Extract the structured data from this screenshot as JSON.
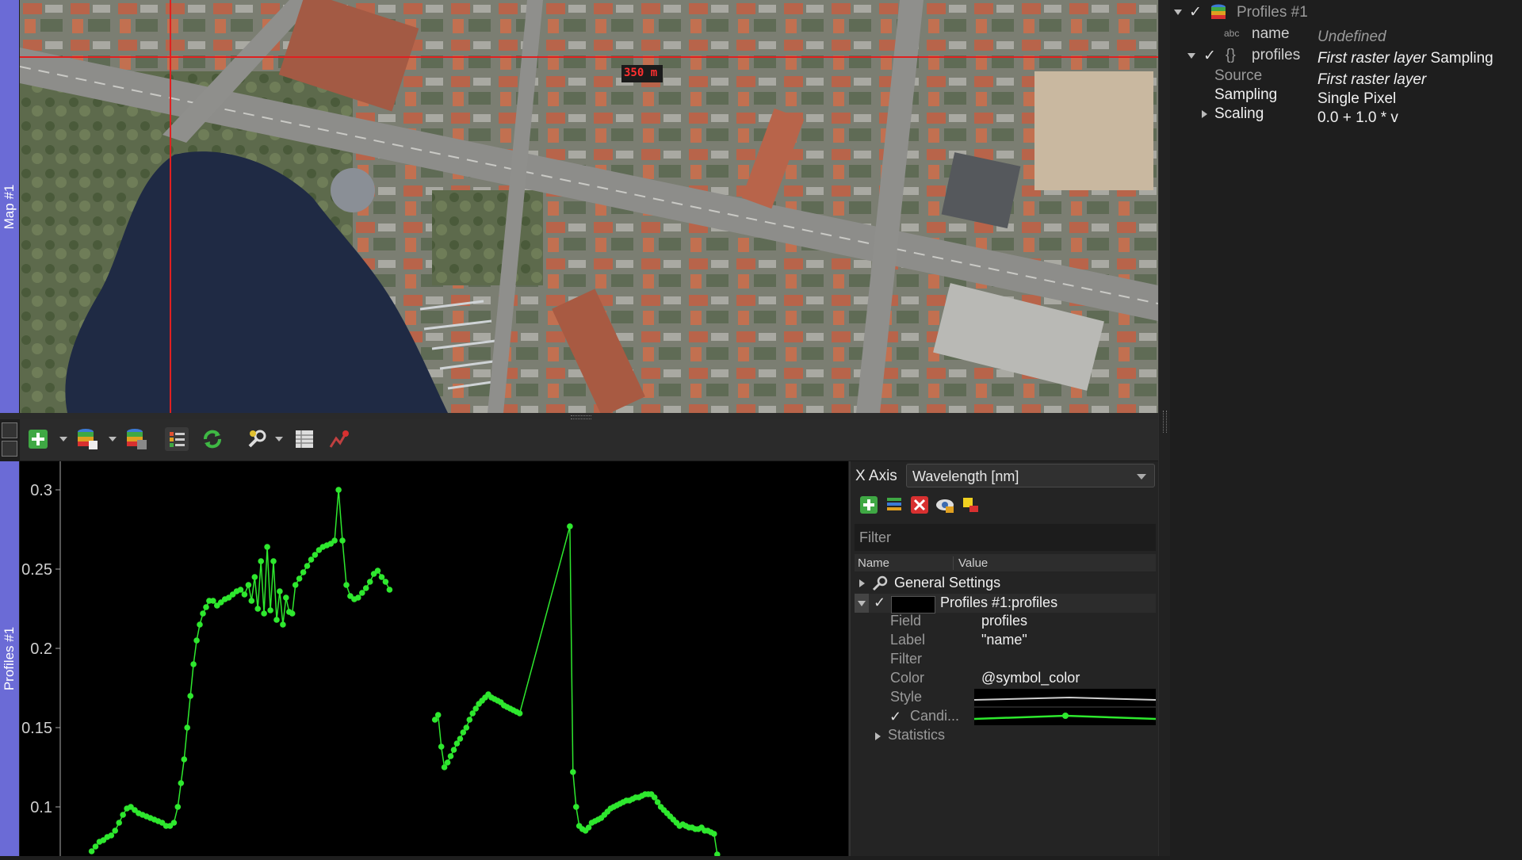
{
  "left_tabs": {
    "map": "Map #1",
    "profiles": "Profiles #1"
  },
  "map": {
    "scale_label": "350 m",
    "crosshair_color": "#e02020"
  },
  "toolbar": {
    "icons": [
      "add-icon",
      "add-profile-source-icon",
      "layer-stack-icon",
      "settings-list-icon",
      "refresh-icon",
      "wrench-settings-icon",
      "table-icon",
      "profile-tool-icon"
    ]
  },
  "plot": {
    "y_ticks": [
      "0.3",
      "0.25",
      "0.2",
      "0.15",
      "0.1"
    ],
    "line_color": "#2ee82e"
  },
  "chart_data": {
    "type": "line",
    "ylim": [
      0.07,
      0.31
    ],
    "xlim": [
      0,
      1000
    ],
    "series": [
      {
        "values": [
          [
            40,
            0.072
          ],
          [
            45,
            0.075
          ],
          [
            50,
            0.078
          ],
          [
            55,
            0.079
          ],
          [
            60,
            0.081
          ],
          [
            65,
            0.082
          ],
          [
            70,
            0.085
          ],
          [
            75,
            0.09
          ],
          [
            80,
            0.095
          ],
          [
            85,
            0.099
          ],
          [
            90,
            0.1
          ],
          [
            95,
            0.098
          ],
          [
            100,
            0.096
          ],
          [
            105,
            0.095
          ],
          [
            110,
            0.094
          ],
          [
            115,
            0.093
          ],
          [
            120,
            0.092
          ],
          [
            125,
            0.091
          ],
          [
            130,
            0.09
          ],
          [
            135,
            0.088
          ],
          [
            140,
            0.088
          ],
          [
            145,
            0.09
          ],
          [
            150,
            0.1
          ],
          [
            154,
            0.115
          ],
          [
            158,
            0.13
          ],
          [
            162,
            0.15
          ],
          [
            166,
            0.17
          ],
          [
            170,
            0.19
          ],
          [
            174,
            0.205
          ],
          [
            178,
            0.215
          ],
          [
            182,
            0.222
          ],
          [
            186,
            0.226
          ],
          [
            190,
            0.23
          ],
          [
            195,
            0.23
          ],
          [
            200,
            0.227
          ],
          [
            205,
            0.229
          ],
          [
            210,
            0.231
          ],
          [
            215,
            0.232
          ],
          [
            220,
            0.234
          ],
          [
            225,
            0.236
          ],
          [
            230,
            0.237
          ],
          [
            235,
            0.234
          ],
          [
            240,
            0.24
          ],
          [
            244,
            0.23
          ],
          [
            248,
            0.245
          ],
          [
            252,
            0.225
          ],
          [
            256,
            0.255
          ],
          [
            260,
            0.222
          ],
          [
            264,
            0.264
          ],
          [
            268,
            0.224
          ],
          [
            272,
            0.255
          ],
          [
            276,
            0.218
          ],
          [
            280,
            0.236
          ],
          [
            284,
            0.215
          ],
          [
            288,
            0.232
          ],
          [
            292,
            0.223
          ],
          [
            296,
            0.222
          ],
          [
            300,
            0.24
          ],
          [
            305,
            0.244
          ],
          [
            310,
            0.248
          ],
          [
            315,
            0.252
          ],
          [
            320,
            0.256
          ],
          [
            325,
            0.259
          ],
          [
            330,
            0.262
          ],
          [
            335,
            0.264
          ],
          [
            340,
            0.265
          ],
          [
            345,
            0.266
          ],
          [
            350,
            0.268
          ],
          [
            355,
            0.3
          ],
          [
            360,
            0.268
          ],
          [
            365,
            0.24
          ],
          [
            370,
            0.233
          ],
          [
            375,
            0.231
          ],
          [
            380,
            0.232
          ],
          [
            385,
            0.235
          ],
          [
            390,
            0.238
          ],
          [
            395,
            0.242
          ],
          [
            400,
            0.247
          ],
          [
            405,
            0.249
          ],
          [
            410,
            0.245
          ],
          [
            415,
            0.242
          ],
          [
            420,
            0.237
          ]
        ]
      },
      {
        "values": [
          [
            478,
            0.155
          ],
          [
            482,
            0.158
          ],
          [
            486,
            0.138
          ],
          [
            490,
            0.125
          ],
          [
            494,
            0.128
          ],
          [
            498,
            0.132
          ],
          [
            502,
            0.136
          ],
          [
            506,
            0.14
          ],
          [
            510,
            0.143
          ],
          [
            514,
            0.147
          ],
          [
            518,
            0.15
          ],
          [
            522,
            0.155
          ],
          [
            526,
            0.159
          ],
          [
            530,
            0.162
          ],
          [
            534,
            0.165
          ],
          [
            538,
            0.167
          ],
          [
            542,
            0.169
          ],
          [
            546,
            0.171
          ],
          [
            550,
            0.169
          ],
          [
            554,
            0.168
          ],
          [
            558,
            0.167
          ],
          [
            562,
            0.166
          ],
          [
            566,
            0.164
          ],
          [
            570,
            0.163
          ],
          [
            574,
            0.162
          ],
          [
            578,
            0.161
          ],
          [
            582,
            0.16
          ],
          [
            586,
            0.159
          ],
          [
            650,
            0.277
          ],
          [
            654,
            0.122
          ],
          [
            658,
            0.1
          ],
          [
            662,
            0.088
          ],
          [
            666,
            0.086
          ],
          [
            670,
            0.085
          ],
          [
            674,
            0.087
          ],
          [
            678,
            0.09
          ],
          [
            682,
            0.091
          ],
          [
            686,
            0.092
          ],
          [
            690,
            0.093
          ],
          [
            694,
            0.095
          ],
          [
            698,
            0.097
          ],
          [
            702,
            0.099
          ],
          [
            706,
            0.1
          ],
          [
            710,
            0.101
          ],
          [
            714,
            0.102
          ],
          [
            718,
            0.103
          ],
          [
            722,
            0.104
          ],
          [
            726,
            0.104
          ],
          [
            730,
            0.105
          ],
          [
            734,
            0.106
          ],
          [
            738,
            0.106
          ],
          [
            742,
            0.107
          ],
          [
            746,
            0.108
          ],
          [
            750,
            0.108
          ],
          [
            754,
            0.108
          ],
          [
            758,
            0.106
          ],
          [
            762,
            0.103
          ],
          [
            766,
            0.1
          ],
          [
            770,
            0.098
          ],
          [
            774,
            0.096
          ],
          [
            778,
            0.094
          ],
          [
            782,
            0.092
          ],
          [
            786,
            0.09
          ],
          [
            790,
            0.088
          ],
          [
            794,
            0.089
          ],
          [
            798,
            0.088
          ],
          [
            802,
            0.087
          ],
          [
            806,
            0.087
          ],
          [
            810,
            0.086
          ],
          [
            814,
            0.086
          ],
          [
            818,
            0.087
          ],
          [
            822,
            0.085
          ],
          [
            826,
            0.085
          ],
          [
            830,
            0.084
          ],
          [
            834,
            0.083
          ],
          [
            838,
            0.07
          ]
        ]
      }
    ]
  },
  "settings": {
    "x_axis_label": "X Axis",
    "x_axis_value": "Wavelength [nm]",
    "filter_placeholder": "Filter",
    "col_name": "Name",
    "col_value": "Value",
    "general_settings": "General Settings",
    "profile_layer": "Profiles #1:profiles",
    "rows": [
      {
        "k": "Field",
        "v": "profiles"
      },
      {
        "k": "Label",
        "v": "\"name\""
      },
      {
        "k": "Filter",
        "v": ""
      },
      {
        "k": "Color",
        "v": "@symbol_color"
      },
      {
        "k": "Style",
        "v": ""
      },
      {
        "k": "Candi...",
        "v": ""
      }
    ],
    "statistics": "Statistics"
  },
  "tree": {
    "root": "Profiles #1",
    "name_key": "name",
    "name_val": "Undefined",
    "profiles_key": "profiles",
    "profiles_val_italic": "First raster layer",
    "profiles_val_plain": " Sampling",
    "source_key": "Source",
    "source_val": "First raster layer",
    "sampling_key": "Sampling",
    "sampling_val": "Single Pixel",
    "scaling_key": "Scaling",
    "scaling_val": "0.0 + 1.0 * v",
    "check": "✓",
    "abc": "abc",
    "braces": "{}"
  }
}
